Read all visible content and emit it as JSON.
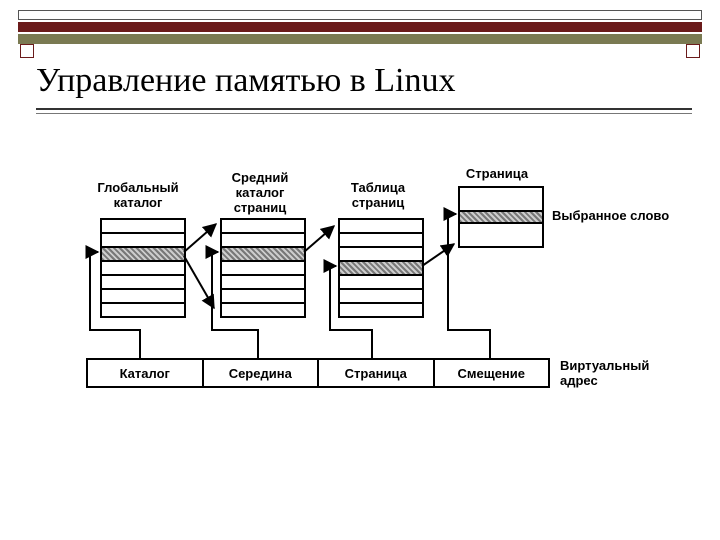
{
  "title": "Управление памятью в Linux",
  "tables": {
    "global": {
      "label": "Глобальный\nкаталог"
    },
    "middle": {
      "label": "Средний\nкаталог\nстраниц"
    },
    "ptable": {
      "label": "Таблица\nстраниц"
    },
    "page": {
      "label": "Страница"
    }
  },
  "page_right_label": "Выбранное слово",
  "vaddr": {
    "segments": [
      "Каталог",
      "Середина",
      "Страница",
      "Смещение"
    ],
    "right_label": "Виртуальный\nадрес"
  }
}
